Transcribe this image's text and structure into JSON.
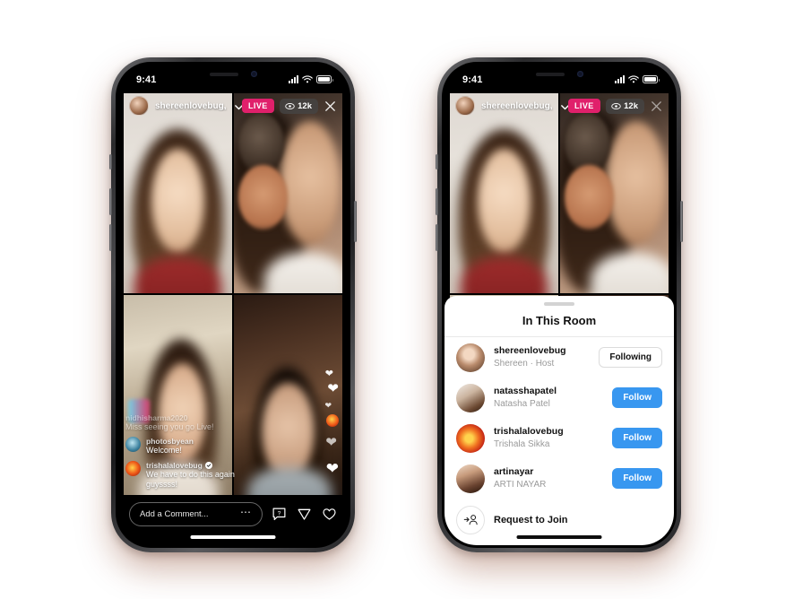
{
  "background": {
    "gradient_from": "#FBC75C",
    "gradient_to": "#EC5351"
  },
  "phones": {
    "left": {
      "status_bar": {
        "time": "9:41",
        "cellular": "signal-bars",
        "wifi": "wifi",
        "battery": "battery-full"
      },
      "live": {
        "host_handle": "shereenlovebug, n...",
        "chevron": "chevron-down-icon",
        "live_label": "LIVE",
        "viewer_count": "12k",
        "viewer_icon": "eye-icon",
        "close_icon": "close-icon",
        "comments": [
          {
            "user": "nidhisharma2020",
            "text": "Miss seeing you go Live!",
            "verified": false,
            "faded": true
          },
          {
            "user": "photosbyean",
            "text": "Welcome!",
            "verified": false,
            "faded": false
          },
          {
            "user": "trishalalovebug",
            "text": "We have to do this again guyssss!",
            "verified": true,
            "faded": false
          }
        ],
        "bottom_bar": {
          "comment_placeholder": "Add a Comment...",
          "more_icon": "ellipsis-icon",
          "icons": [
            "question-icon",
            "share-icon",
            "heart-icon"
          ]
        },
        "reactions": "floating-hearts"
      }
    },
    "right": {
      "status_bar": {
        "time": "9:41",
        "cellular": "signal-bars",
        "wifi": "wifi",
        "battery": "battery-full"
      },
      "live": {
        "host_handle": "shereenlovebug, n...",
        "chevron": "chevron-down-icon",
        "live_label": "LIVE",
        "viewer_count": "12k",
        "viewer_icon": "eye-icon",
        "close_icon": "close-icon"
      },
      "sheet": {
        "title": "In This Room",
        "grabber": "drag-handle",
        "participants": [
          {
            "username": "shereenlovebug",
            "subtitle": "Shereen · Host",
            "action": "Following",
            "action_style": "following",
            "avatar": "av1"
          },
          {
            "username": "natasshapatel",
            "subtitle": "Natasha Patel",
            "action": "Follow",
            "action_style": "follow",
            "avatar": "av2"
          },
          {
            "username": "trishalalovebug",
            "subtitle": "Trishala Sikka",
            "action": "Follow",
            "action_style": "follow",
            "avatar": "av3"
          },
          {
            "username": "artinayar",
            "subtitle": "ARTI NAYAR",
            "action": "Follow",
            "action_style": "follow",
            "avatar": "av4"
          }
        ],
        "request_row": {
          "label": "Request to Join",
          "icon": "add-person-icon"
        }
      }
    }
  },
  "colors": {
    "live_badge": "#E0206B",
    "follow_button": "#3897F0",
    "sheet_background": "#FFFFFF"
  }
}
